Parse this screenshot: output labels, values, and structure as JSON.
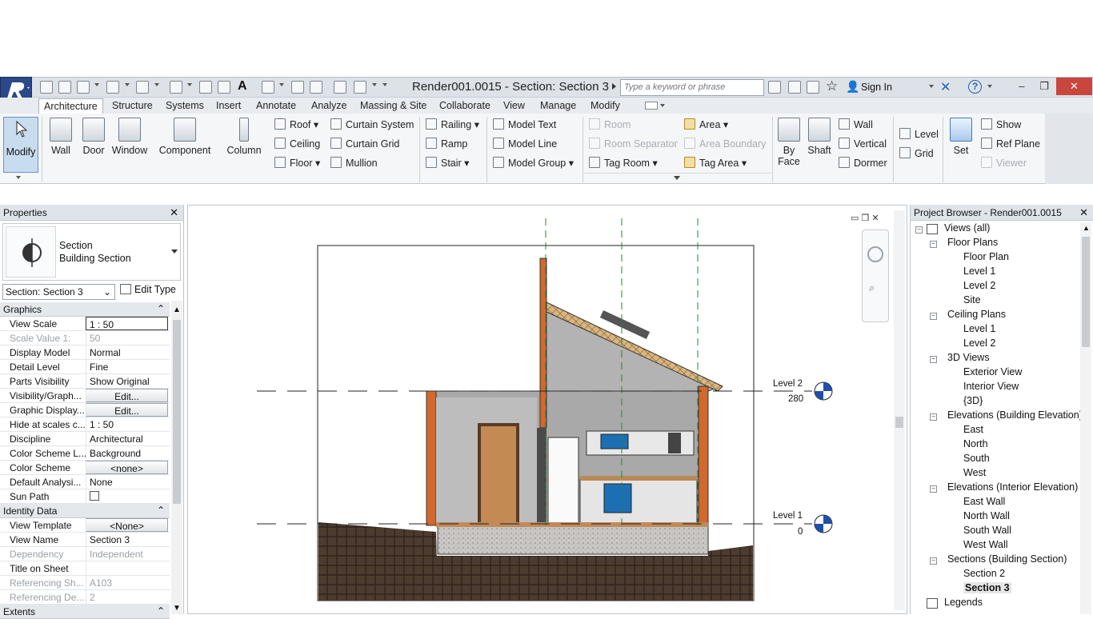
{
  "window": {
    "title": "Render001.0015 - Section: Section 3",
    "close": "✕",
    "minimize": "‒",
    "restore": "❐"
  },
  "search": {
    "placeholder": "Type a keyword or phrase"
  },
  "signin": "Sign In",
  "tabs": [
    "Architecture",
    "Structure",
    "Systems",
    "Insert",
    "Annotate",
    "Analyze",
    "Massing & Site",
    "Collaborate",
    "View",
    "Manage",
    "Modify"
  ],
  "ribbon": {
    "modify": "Modify",
    "wall": "Wall",
    "door": "Door",
    "window": "Window",
    "component": "Component",
    "column": "Column",
    "roof": "Roof",
    "ceiling": "Ceiling",
    "floor": "Floor",
    "curtain_system": "Curtain  System",
    "curtain_grid": "Curtain  Grid",
    "mullion": "Mullion",
    "railing": "Railing",
    "ramp": "Ramp",
    "stair": "Stair",
    "model_text": "Model  Text",
    "model_line": "Model  Line",
    "model_group": "Model  Group",
    "room": "Room",
    "room_separator": "Room  Separator",
    "tag_room": "Tag  Room",
    "area": "Area",
    "area_boundary": "Area  Boundary",
    "tag_area": "Tag  Area",
    "by_face": "By",
    "by_face2": "Face",
    "shaft": "Shaft",
    "wall_opening": "Wall",
    "vertical": "Vertical",
    "dormer": "Dormer",
    "level": "Level",
    "grid": "Grid",
    "set": "Set",
    "show": "Show",
    "ref_plane": "Ref  Plane",
    "viewer": "Viewer"
  },
  "properties": {
    "title": "Properties",
    "type_name": "Section",
    "type_sub": "Building Section",
    "selector": "Section: Section 3",
    "edit_type": "Edit Type",
    "groups": {
      "graphics": "Graphics",
      "identity": "Identity Data",
      "extents": "Extents"
    },
    "rows": [
      {
        "k": "View Scale",
        "v": "1 : 50"
      },
      {
        "k": "Scale Value    1:",
        "v": "50"
      },
      {
        "k": "Display Model",
        "v": "Normal"
      },
      {
        "k": "Detail Level",
        "v": "Fine"
      },
      {
        "k": "Parts Visibility",
        "v": "Show Original"
      },
      {
        "k": "Visibility/Graph...",
        "v": "Edit..."
      },
      {
        "k": "Graphic Display...",
        "v": "Edit..."
      },
      {
        "k": "Hide at scales c...",
        "v": "1 : 50"
      },
      {
        "k": "Discipline",
        "v": "Architectural"
      },
      {
        "k": "Color Scheme L...",
        "v": "Background"
      },
      {
        "k": "Color Scheme",
        "v": "<none>"
      },
      {
        "k": "Default Analysi...",
        "v": "None"
      },
      {
        "k": "Sun Path",
        "v": ""
      }
    ],
    "identity_rows": [
      {
        "k": "View Template",
        "v": "<None>"
      },
      {
        "k": "View Name",
        "v": "Section 3"
      },
      {
        "k": "Dependency",
        "v": "Independent"
      },
      {
        "k": "Title on Sheet",
        "v": ""
      },
      {
        "k": "Referencing Sh...",
        "v": "A103"
      },
      {
        "k": "Referencing De...",
        "v": "2"
      }
    ]
  },
  "canvas": {
    "level2": {
      "name": "Level 2",
      "elev": "280"
    },
    "level1": {
      "name": "Level 1",
      "elev": "0"
    }
  },
  "browser": {
    "title": "Project Browser - Render001.0015",
    "nodes": [
      "Views (all)",
      "Floor Plans",
      "Floor Plan",
      "Level 1",
      "Level 2",
      "Site",
      "Ceiling Plans",
      "Level 1",
      "Level 2",
      "3D Views",
      "Exterior View",
      "Interior View",
      "{3D}",
      "Elevations (Building Elevation)",
      "East",
      "North",
      "South",
      "West",
      "Elevations (Interior Elevation)",
      "East Wall",
      "North Wall",
      "South Wall",
      "West Wall",
      "Sections (Building Section)",
      "Section 2",
      "Section 3",
      "Legends"
    ]
  },
  "colors": {
    "accent": "#2b4a8a",
    "ground": "#4a3a2e",
    "brick": "#d2692c",
    "wall": "#bfbfbf",
    "roof": "#d8b37a"
  }
}
